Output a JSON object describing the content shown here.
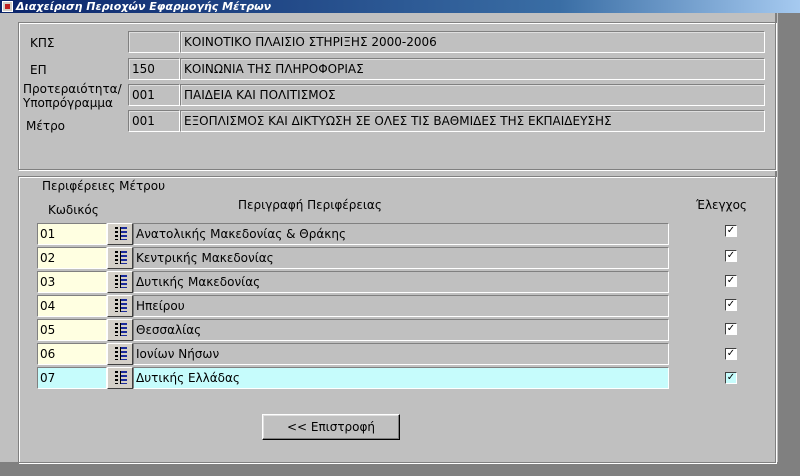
{
  "window": {
    "title": "Διαχείριση Περιοχών Εφαρμογής Μέτρων"
  },
  "header": {
    "kps": {
      "label": "ΚΠΣ",
      "code": "",
      "description": "ΚΟΙΝΟΤΙΚΟ ΠΛΑΙΣΙΟ ΣΤΗΡΙΞΗΣ 2000-2006"
    },
    "ep": {
      "label": "ΕΠ",
      "code": "150",
      "description": "ΚΟΙΝΩΝΙΑ ΤΗΣ ΠΛΗΡΟΦΟΡΙΑΣ"
    },
    "priority": {
      "label_line1": "Προτεραιότητα/",
      "label_line2": "Υποπρόγραμμα",
      "code": "001",
      "description": "ΠΑΙΔΕΙΑ ΚΑΙ ΠΟΛΙΤΙΣΜΟΣ"
    },
    "measure": {
      "label": "Μέτρο",
      "code": "001",
      "description": "ΕΞΟΠΛΙΣΜΟΣ ΚΑΙ ΔΙΚΤΥΩΣΗ ΣΕ ΟΛΕΣ ΤΙΣ ΒΑΘΜΙΔΕΣ ΤΗΣ ΕΚΠΑΙΔΕΥΣΗΣ"
    }
  },
  "regions": {
    "title": "Περιφέρειες Μέτρου",
    "col_code": "Κωδικός",
    "col_desc": "Περιγραφή Περιφέρειας",
    "col_check": "Έλεγχος",
    "check_mark": "✓",
    "rows": [
      {
        "code": "01",
        "description": "Ανατολικής Μακεδονίας & Θράκης",
        "checked": true
      },
      {
        "code": "02",
        "description": "Κεντρικής Μακεδονίας",
        "checked": true
      },
      {
        "code": "03",
        "description": "Δυτικής Μακεδονίας",
        "checked": true
      },
      {
        "code": "04",
        "description": "Ηπείρου",
        "checked": true
      },
      {
        "code": "05",
        "description": "Θεσσαλίας",
        "checked": true
      },
      {
        "code": "06",
        "description": "Ιονίων Νήσων",
        "checked": true
      },
      {
        "code": "07",
        "description": "Δυτικής Ελλάδας",
        "checked": true
      }
    ]
  },
  "actions": {
    "back_label": "<< Επιστροφή"
  },
  "colors": {
    "active_row": "#c6fcfc",
    "code_field": "#ffffe1",
    "titlebar": "#0a246a"
  }
}
